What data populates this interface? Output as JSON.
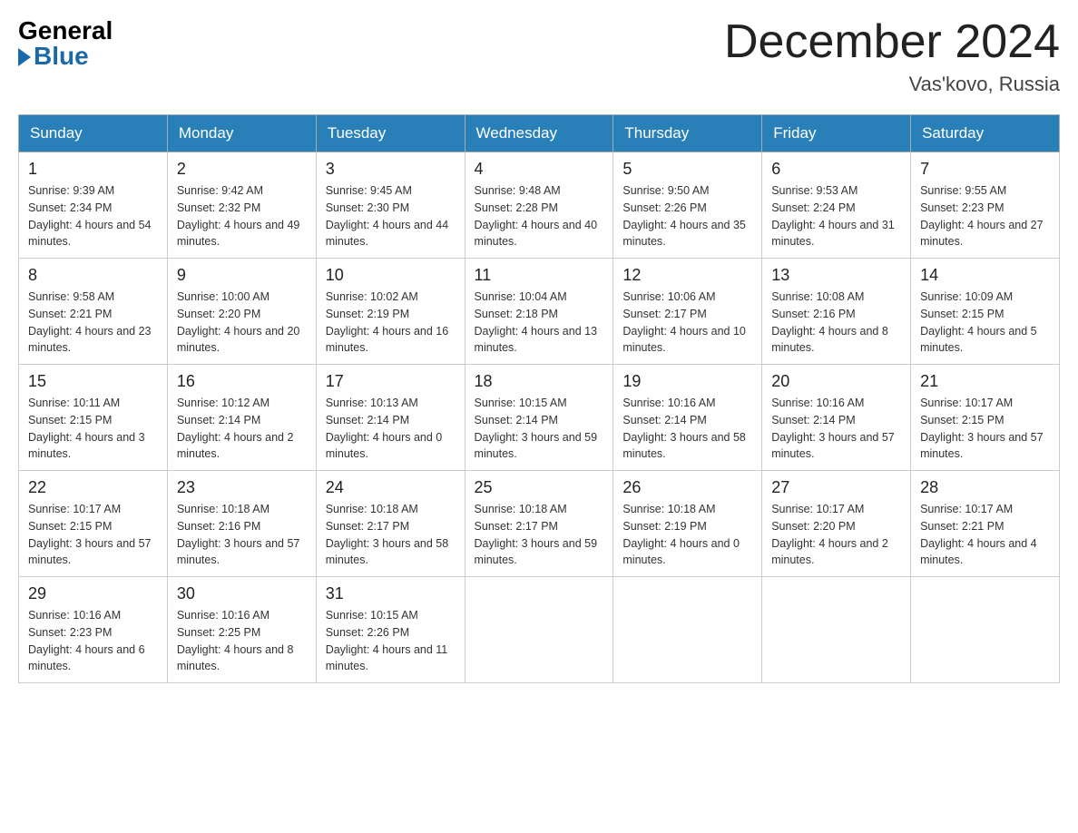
{
  "logo": {
    "general": "General",
    "blue": "Blue"
  },
  "header": {
    "month": "December 2024",
    "location": "Vas'kovo, Russia"
  },
  "days_of_week": [
    "Sunday",
    "Monday",
    "Tuesday",
    "Wednesday",
    "Thursday",
    "Friday",
    "Saturday"
  ],
  "weeks": [
    [
      {
        "day": "1",
        "sunrise": "9:39 AM",
        "sunset": "2:34 PM",
        "daylight": "4 hours and 54 minutes."
      },
      {
        "day": "2",
        "sunrise": "9:42 AM",
        "sunset": "2:32 PM",
        "daylight": "4 hours and 49 minutes."
      },
      {
        "day": "3",
        "sunrise": "9:45 AM",
        "sunset": "2:30 PM",
        "daylight": "4 hours and 44 minutes."
      },
      {
        "day": "4",
        "sunrise": "9:48 AM",
        "sunset": "2:28 PM",
        "daylight": "4 hours and 40 minutes."
      },
      {
        "day": "5",
        "sunrise": "9:50 AM",
        "sunset": "2:26 PM",
        "daylight": "4 hours and 35 minutes."
      },
      {
        "day": "6",
        "sunrise": "9:53 AM",
        "sunset": "2:24 PM",
        "daylight": "4 hours and 31 minutes."
      },
      {
        "day": "7",
        "sunrise": "9:55 AM",
        "sunset": "2:23 PM",
        "daylight": "4 hours and 27 minutes."
      }
    ],
    [
      {
        "day": "8",
        "sunrise": "9:58 AM",
        "sunset": "2:21 PM",
        "daylight": "4 hours and 23 minutes."
      },
      {
        "day": "9",
        "sunrise": "10:00 AM",
        "sunset": "2:20 PM",
        "daylight": "4 hours and 20 minutes."
      },
      {
        "day": "10",
        "sunrise": "10:02 AM",
        "sunset": "2:19 PM",
        "daylight": "4 hours and 16 minutes."
      },
      {
        "day": "11",
        "sunrise": "10:04 AM",
        "sunset": "2:18 PM",
        "daylight": "4 hours and 13 minutes."
      },
      {
        "day": "12",
        "sunrise": "10:06 AM",
        "sunset": "2:17 PM",
        "daylight": "4 hours and 10 minutes."
      },
      {
        "day": "13",
        "sunrise": "10:08 AM",
        "sunset": "2:16 PM",
        "daylight": "4 hours and 8 minutes."
      },
      {
        "day": "14",
        "sunrise": "10:09 AM",
        "sunset": "2:15 PM",
        "daylight": "4 hours and 5 minutes."
      }
    ],
    [
      {
        "day": "15",
        "sunrise": "10:11 AM",
        "sunset": "2:15 PM",
        "daylight": "4 hours and 3 minutes."
      },
      {
        "day": "16",
        "sunrise": "10:12 AM",
        "sunset": "2:14 PM",
        "daylight": "4 hours and 2 minutes."
      },
      {
        "day": "17",
        "sunrise": "10:13 AM",
        "sunset": "2:14 PM",
        "daylight": "4 hours and 0 minutes."
      },
      {
        "day": "18",
        "sunrise": "10:15 AM",
        "sunset": "2:14 PM",
        "daylight": "3 hours and 59 minutes."
      },
      {
        "day": "19",
        "sunrise": "10:16 AM",
        "sunset": "2:14 PM",
        "daylight": "3 hours and 58 minutes."
      },
      {
        "day": "20",
        "sunrise": "10:16 AM",
        "sunset": "2:14 PM",
        "daylight": "3 hours and 57 minutes."
      },
      {
        "day": "21",
        "sunrise": "10:17 AM",
        "sunset": "2:15 PM",
        "daylight": "3 hours and 57 minutes."
      }
    ],
    [
      {
        "day": "22",
        "sunrise": "10:17 AM",
        "sunset": "2:15 PM",
        "daylight": "3 hours and 57 minutes."
      },
      {
        "day": "23",
        "sunrise": "10:18 AM",
        "sunset": "2:16 PM",
        "daylight": "3 hours and 57 minutes."
      },
      {
        "day": "24",
        "sunrise": "10:18 AM",
        "sunset": "2:17 PM",
        "daylight": "3 hours and 58 minutes."
      },
      {
        "day": "25",
        "sunrise": "10:18 AM",
        "sunset": "2:17 PM",
        "daylight": "3 hours and 59 minutes."
      },
      {
        "day": "26",
        "sunrise": "10:18 AM",
        "sunset": "2:19 PM",
        "daylight": "4 hours and 0 minutes."
      },
      {
        "day": "27",
        "sunrise": "10:17 AM",
        "sunset": "2:20 PM",
        "daylight": "4 hours and 2 minutes."
      },
      {
        "day": "28",
        "sunrise": "10:17 AM",
        "sunset": "2:21 PM",
        "daylight": "4 hours and 4 minutes."
      }
    ],
    [
      {
        "day": "29",
        "sunrise": "10:16 AM",
        "sunset": "2:23 PM",
        "daylight": "4 hours and 6 minutes."
      },
      {
        "day": "30",
        "sunrise": "10:16 AM",
        "sunset": "2:25 PM",
        "daylight": "4 hours and 8 minutes."
      },
      {
        "day": "31",
        "sunrise": "10:15 AM",
        "sunset": "2:26 PM",
        "daylight": "4 hours and 11 minutes."
      },
      null,
      null,
      null,
      null
    ]
  ]
}
